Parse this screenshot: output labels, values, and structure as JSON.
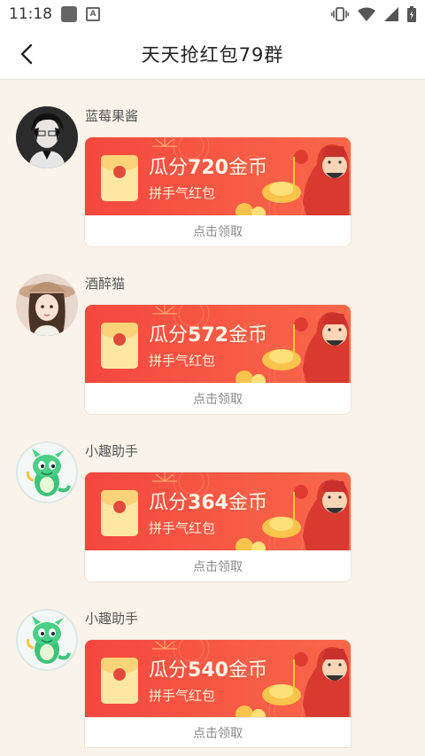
{
  "status": {
    "time": "11:18",
    "a_badge": "A"
  },
  "header": {
    "title": "天天抢红包79群"
  },
  "messages": [
    {
      "sender": "蓝莓果酱",
      "packet": {
        "prefix": "瓜分",
        "amount": "720",
        "unit": "金币",
        "subtitle": "拼手气红包",
        "action": "点击领取"
      }
    },
    {
      "sender": "酒醉猫",
      "packet": {
        "prefix": "瓜分",
        "amount": "572",
        "unit": "金币",
        "subtitle": "拼手气红包",
        "action": "点击领取"
      }
    },
    {
      "sender": "小趣助手",
      "packet": {
        "prefix": "瓜分",
        "amount": "364",
        "unit": "金币",
        "subtitle": "拼手气红包",
        "action": "点击领取"
      }
    },
    {
      "sender": "小趣助手",
      "packet": {
        "prefix": "瓜分",
        "amount": "540",
        "unit": "金币",
        "subtitle": "拼手气红包",
        "action": "点击领取"
      }
    }
  ],
  "colors": {
    "packet_red": "#f4473f",
    "envelope_gold": "#fde7a2",
    "page_bg": "#faf3ea"
  },
  "icons": {
    "back": "chevron-left-icon",
    "vibrate": "vibrate-icon",
    "wifi": "wifi-icon",
    "signal": "signal-icon",
    "battery": "battery-icon"
  }
}
